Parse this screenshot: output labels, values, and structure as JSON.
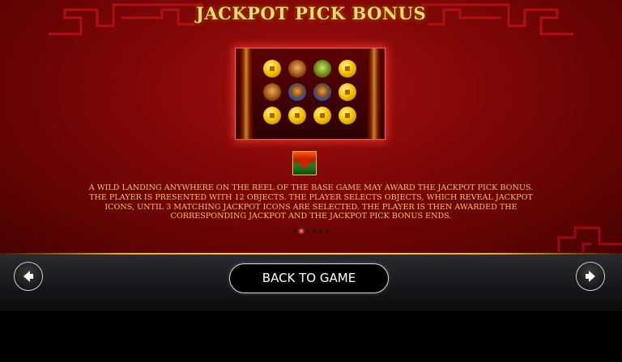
{
  "title": "JACKPOT PICK BONUS",
  "description": "A WILD LANDING ANYWHERE ON THE REEL OF THE BASE GAME MAY AWARD THE JACKPOT PICK BONUS. THE PLAYER IS PRESENTED WITH 12 OBJECTS. THE PLAYER SELECTS OBJECTS, WHICH REVEAL JACKPOT ICONS, UNTIL 3 MATCHING JACKPOT ICONS ARE SELECTED. THE PLAYER IS THEN AWARDED THE CORRESPONDING JACKPOT AND THE JACKPOT PICK BONUS ENDS.",
  "preview_symbols": [
    [
      "coin",
      "dragon",
      "dragon-green",
      "coin"
    ],
    [
      "dragon",
      "dragon-blue",
      "dragon-blue",
      "coin"
    ],
    [
      "coin",
      "coin",
      "coin",
      "coin"
    ]
  ],
  "pager": {
    "total": 6,
    "active_index": 1
  },
  "buttons": {
    "back_to_game": "BACK TO GAME"
  },
  "icons": {
    "prev": "arrow-left-icon",
    "next": "arrow-right-icon",
    "wild": "wild-symbol-icon"
  },
  "colors": {
    "panel_red": "#7d0606",
    "title_gold": "#ffd86a",
    "text_gold": "#f2c45a",
    "bar_dark": "#16161a"
  }
}
